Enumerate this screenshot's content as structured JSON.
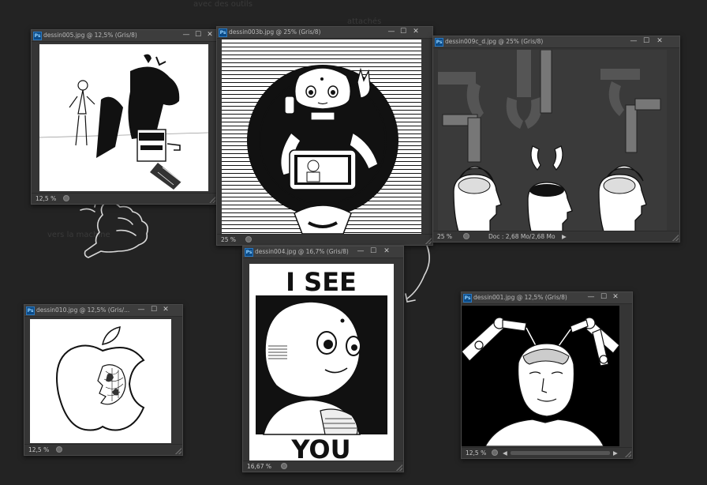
{
  "windows": [
    {
      "id": "w1",
      "title": "dessin005.jpg @ 12,5% (Gris/8)",
      "zoom": "12,5 %"
    },
    {
      "id": "w2",
      "title": "dessin003b.jpg @ 25% (Gris/8)",
      "zoom": "25 %"
    },
    {
      "id": "w3",
      "title": "dessin009c_d.jpg @ 25% (Gris/8)",
      "zoom": "25 %",
      "doc_info": "Doc : 2,68 Mo/2,68 Mo",
      "arrow": "▶"
    },
    {
      "id": "w4",
      "title": "dessin004.jpg @ 16,7% (Gris/8)",
      "zoom": "16,67 %"
    },
    {
      "id": "w5",
      "title": "dessin010.jpg @ 12,5% (Gris/...",
      "zoom": "12,5 %"
    },
    {
      "id": "w6",
      "title": "dessin001.jpg @ 12,5% (Gris/8)",
      "zoom": "12,5 %",
      "arrow_left": "◀",
      "arrow_right": "▶"
    }
  ],
  "window_buttons": {
    "minimize": "—",
    "maximize": "☐",
    "close": "✕"
  },
  "poster": {
    "top": "I SEE",
    "bottom": "YOU"
  },
  "background_text": [
    "avec des outils",
    "attachés",
    "vers la machine"
  ],
  "colors": {
    "desktop": "#232323",
    "panel": "#353535",
    "title": "#3d3d3d",
    "ps_blue": "#0b4a86"
  }
}
